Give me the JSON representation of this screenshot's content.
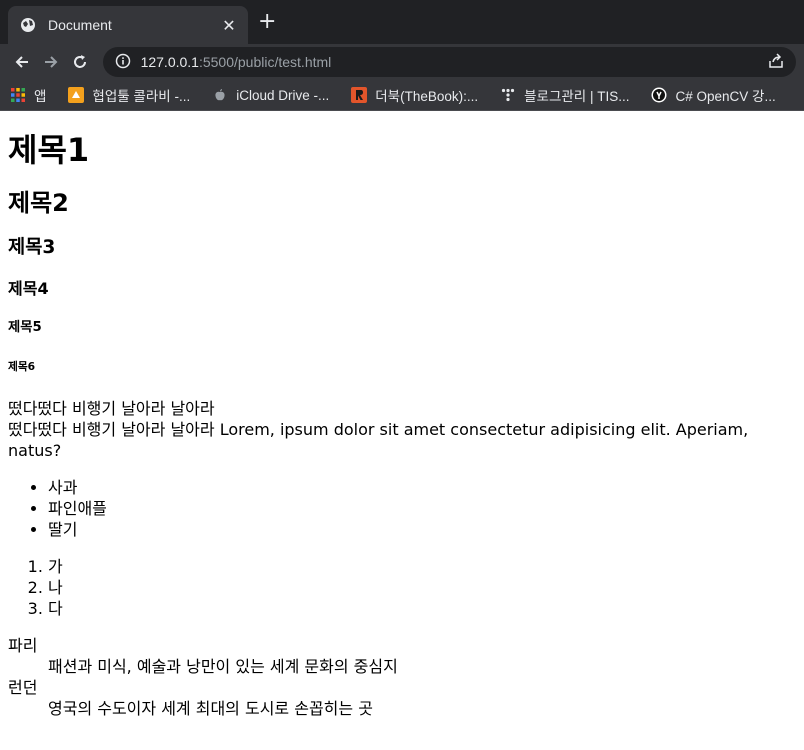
{
  "browser": {
    "tab_title": "Document",
    "url_host": "127.0.0.1",
    "url_path": ":5500/public/test.html",
    "bookmarks": [
      {
        "label": "앱",
        "icon": "apps-grid-icon",
        "color": "#ea4335"
      },
      {
        "label": "협업툴 콜라비 -...",
        "icon": "collabee-icon",
        "color": "#f4a11d"
      },
      {
        "label": "iCloud Drive -...",
        "icon": "apple-icon",
        "color": "#9aa0a6"
      },
      {
        "label": "더북(TheBook):...",
        "icon": "thebook-icon",
        "color": "#e2552b"
      },
      {
        "label": "블로그관리 | TIS...",
        "icon": "tistory-icon",
        "color": "#202124"
      },
      {
        "label": "C# OpenCV 강...",
        "icon": "opencv-blog-icon",
        "color": "#111111"
      }
    ]
  },
  "content": {
    "h1": "제목1",
    "h2": "제목2",
    "h3": "제목3",
    "h4": "제목4",
    "h5": "제목5",
    "h6": "제목6",
    "paragraph_line1": "떴다떴다 비행기 날아라 날아라",
    "paragraph_line2": "떴다떴다 비행기 날아라 날아라 Lorem, ipsum dolor sit amet consectetur adipisicing elit. Aperiam, natus?",
    "unordered": [
      "사과",
      "파인애플",
      "딸기"
    ],
    "ordered": [
      "가",
      "나",
      "다"
    ],
    "definitions": [
      {
        "term": "파리",
        "desc": "패션과 미식, 예술과 낭만이 있는 세계 문화의 중심지"
      },
      {
        "term": "런던",
        "desc": "영국의 수도이자 세계 최대의 도시로 손꼽히는 곳"
      }
    ]
  }
}
